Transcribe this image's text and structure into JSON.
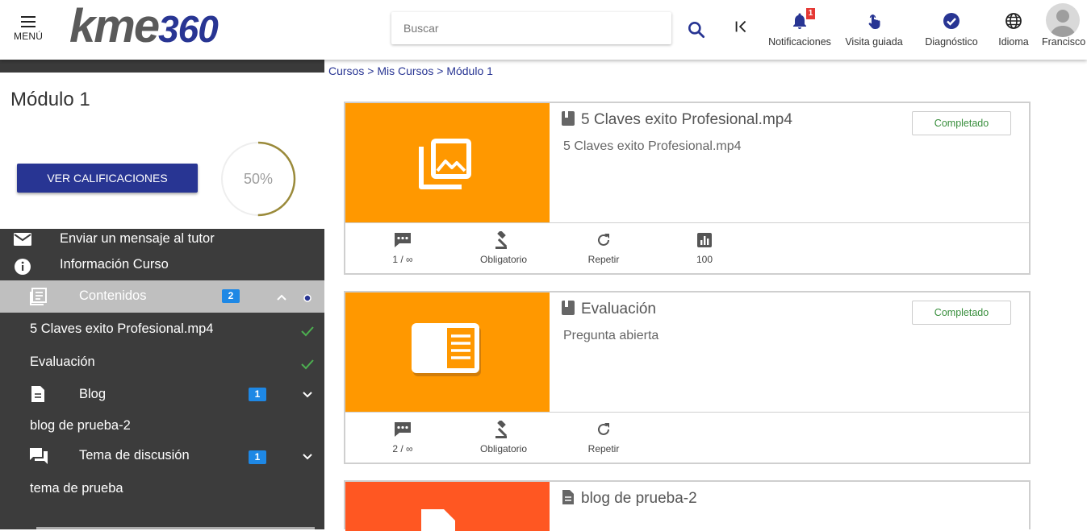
{
  "header": {
    "menu_label": "MENÚ",
    "logo_text": "kme",
    "logo_num": "360",
    "search_placeholder": "Buscar",
    "notifications_label": "Notificaciones",
    "notifications_count": "1",
    "guided_tour_label": "Visita guiada",
    "diagnostic_label": "Diagnóstico",
    "language_label": "Idioma",
    "user_name": "Francisco"
  },
  "breadcrumb": {
    "items": [
      "Cursos",
      "Mis Cursos",
      "Módulo 1"
    ],
    "separator": ">"
  },
  "sidebar": {
    "module_title": "Módulo 1",
    "grades_button": "VER CALIFICACIONES",
    "progress_text": "50%",
    "progress_value": 0.5,
    "message_tutor": "Enviar un mensaje al tutor",
    "course_info": "Información Curso",
    "contents_label": "Contenidos",
    "contents_count": "2",
    "content_items": [
      "5 Claves exito Profesional.mp4",
      "Evaluación"
    ],
    "blog_label": "Blog",
    "blog_count": "1",
    "blog_item": "blog de prueba-2",
    "discussion_label": "Tema de discusión",
    "discussion_count": "1",
    "discussion_item": "tema de prueba"
  },
  "cards": [
    {
      "title": "5 Claves exito Profesional.mp4",
      "description": "5 Claves exito Profesional.mp4",
      "status": "Completado",
      "attempts": "1 / ∞",
      "mandatory": "Obligatorio",
      "repeat": "Repetir",
      "score": "100"
    },
    {
      "title": "Evaluación",
      "description": "Pregunta abierta",
      "status": "Completado",
      "attempts": "2 / ∞",
      "mandatory": "Obligatorio",
      "repeat": "Repetir"
    },
    {
      "title": "blog de prueba-2"
    }
  ],
  "colors": {
    "primary": "#283593",
    "orange": "#ff9800",
    "red_orange": "#ff5722",
    "sidebar_dark": "#3c3c3c",
    "badge_blue": "#1e88e5",
    "complete_green": "#388e3c"
  }
}
